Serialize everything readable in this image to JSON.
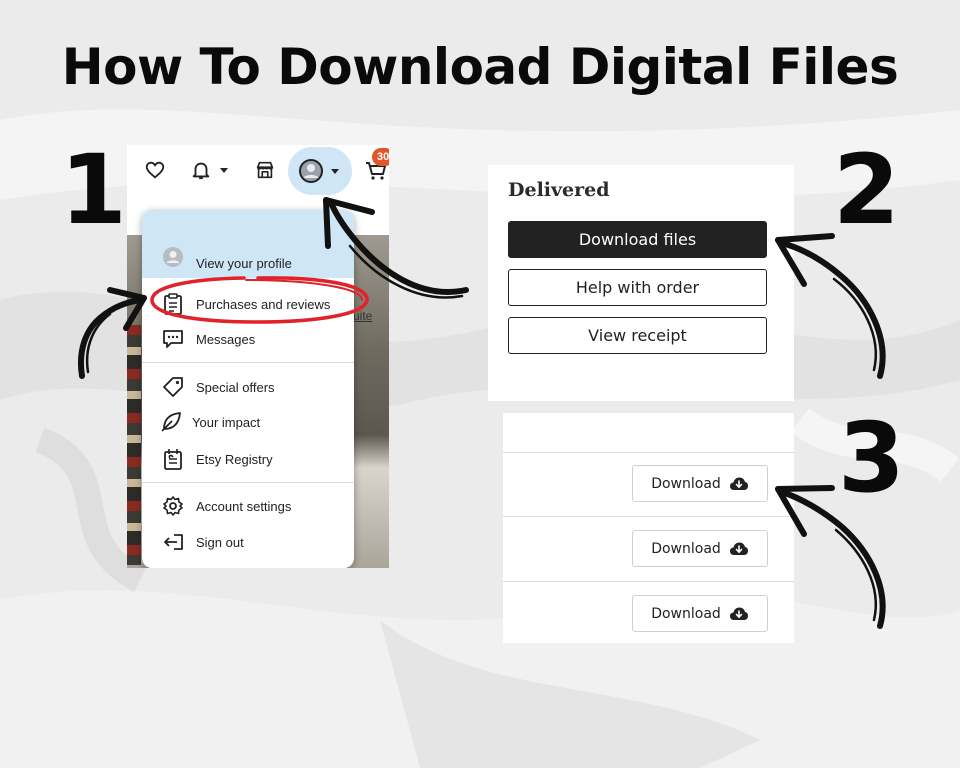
{
  "title": "How To Download Digital Files",
  "steps": [
    "1",
    "2",
    "3"
  ],
  "panel1": {
    "cart_count": "30",
    "menu_items": [
      {
        "label": "View your profile",
        "icon": "user-avatar-icon"
      },
      {
        "label": "Purchases and reviews",
        "icon": "clipboard-icon"
      },
      {
        "label": "Messages",
        "icon": "message-icon"
      },
      {
        "label": "Special offers",
        "icon": "tag-icon"
      },
      {
        "label": "Your impact",
        "icon": "leaf-icon"
      },
      {
        "label": "Etsy Registry",
        "icon": "gift-registry-icon"
      },
      {
        "label": "Account settings",
        "icon": "gear-icon"
      },
      {
        "label": "Sign out",
        "icon": "sign-out-icon"
      }
    ],
    "bg_link_fragment": "uite"
  },
  "panel2": {
    "heading": "Delivered",
    "download_files": "Download files",
    "help_with_order": "Help with order",
    "view_receipt": "View receipt"
  },
  "panel3": {
    "download_label": "Download",
    "rows": 3
  },
  "colors": {
    "highlight_blue": "#cfe6f7",
    "annotation_red": "#e0222a",
    "badge_orange": "#e3552b",
    "ink": "#0a0a0a"
  }
}
